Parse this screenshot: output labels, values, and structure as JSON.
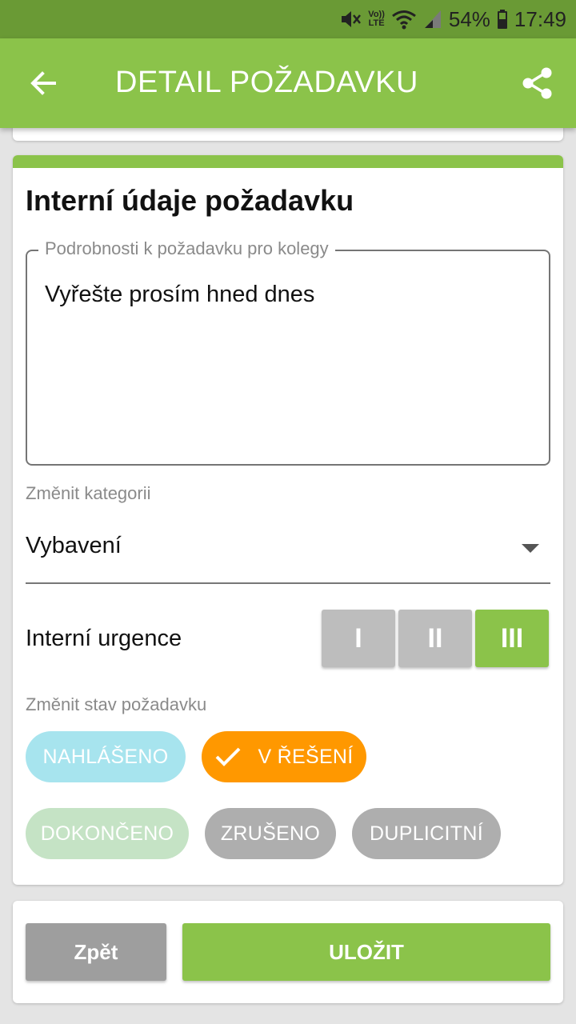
{
  "status_bar": {
    "volte_top": "Vo))",
    "volte_bottom": "LTE",
    "battery": "54%",
    "time": "17:49",
    "icons": [
      "mute-icon",
      "volte-icon",
      "wifi-icon",
      "signal-icon",
      "battery-icon"
    ]
  },
  "app_bar": {
    "title": "DETAIL POŽADAVKU",
    "back_icon": "arrow-back-icon",
    "share_icon": "share-icon"
  },
  "card": {
    "title": "Interní údaje požadavku",
    "notes": {
      "label": "Podrobnosti k požadavku pro kolegy",
      "value": "Vyřešte prosím hned dnes"
    },
    "category": {
      "label": "Změnit kategorii",
      "value": "Vybavení"
    },
    "urgency": {
      "label": "Interní urgence",
      "options": [
        "I",
        "II",
        "III"
      ],
      "selected": "III"
    },
    "state": {
      "label": "Změnit stav požadavku",
      "options": [
        "NAHLÁŠENO",
        "V ŘEŠENÍ",
        "DOKONČENO",
        "ZRUŠENO",
        "DUPLICITNÍ"
      ],
      "selected": "V ŘEŠENÍ"
    }
  },
  "footer": {
    "back_label": "Zpět",
    "save_label": "ULOŽIT"
  },
  "colors": {
    "status_bar": "#6a9a35",
    "primary": "#8bc34a",
    "state_reported": "#a7e4ee",
    "state_in_progress": "#ff9800",
    "state_done": "#c5e3c5",
    "state_neutral": "#aeaeae",
    "inactive_button": "#bdbdbd"
  }
}
